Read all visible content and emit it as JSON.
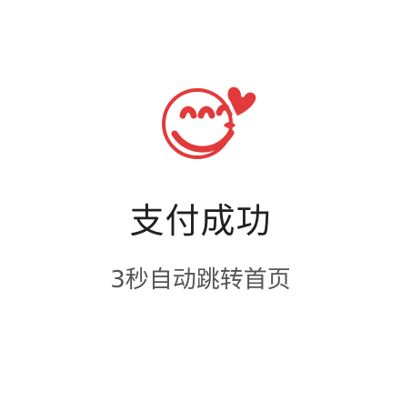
{
  "icon": {
    "name": "happy-heart-face-icon",
    "color": "#e23a3a"
  },
  "status": {
    "title": "支付成功",
    "subtitle": "3秒自动跳转首页"
  },
  "colors": {
    "title": "#202020",
    "subtitle": "#555555",
    "accent": "#e23a3a",
    "background": "#ffffff"
  }
}
